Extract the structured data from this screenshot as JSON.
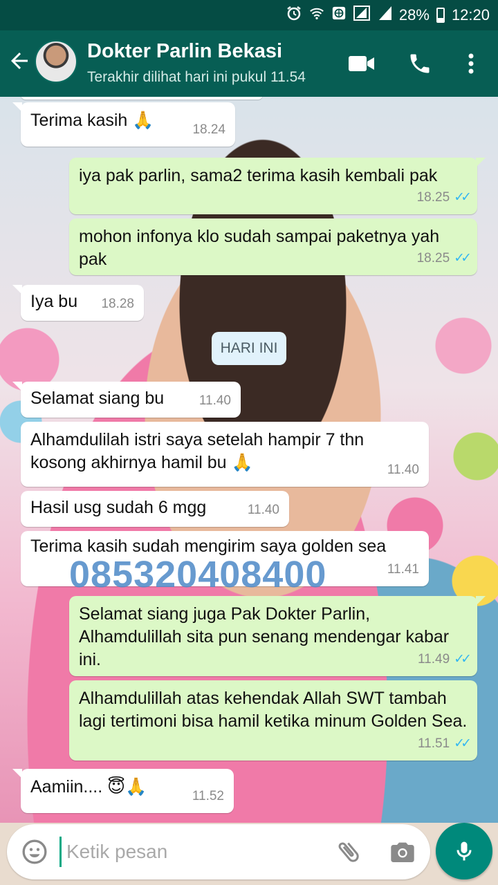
{
  "status_bar": {
    "battery": "28%",
    "time": "12:20"
  },
  "header": {
    "contact_name": "Dokter Parlin Bekasi",
    "last_seen": "Terakhir dilihat hari ini pukul 11.54"
  },
  "messages": [
    {
      "dir": "in",
      "text": "Terima kasih 🙏",
      "time": "18.24"
    },
    {
      "dir": "out",
      "text": "iya pak parlin, sama2 terima kasih kembali pak",
      "time": "18.25",
      "read": true
    },
    {
      "dir": "out",
      "text": "mohon infonya klo sudah sampai paketnya yah pak",
      "time": "18.25",
      "read": true
    },
    {
      "dir": "in",
      "text": "Iya bu",
      "time": "18.28"
    },
    {
      "dir": "in",
      "text": "Selamat siang bu",
      "time": "11.40"
    },
    {
      "dir": "in",
      "text": "Alhamdulilah istri saya setelah hampir 7 thn kosong akhirnya hamil bu 🙏",
      "time": "11.40"
    },
    {
      "dir": "in",
      "text": "Hasil usg sudah 6 mgg",
      "time": "11.40"
    },
    {
      "dir": "in",
      "text": "Terima kasih sudah mengirim saya golden sea",
      "time": "11.41"
    },
    {
      "dir": "out",
      "text": "Selamat siang juga Pak Dokter Parlin, Alhamdulillah sita pun senang mendengar kabar ini.",
      "time": "11.49",
      "read": true
    },
    {
      "dir": "out",
      "text": "Alhamdulillah atas kehendak Allah SWT tambah lagi tertimoni bisa hamil ketika minum Golden Sea.",
      "time": "11.51",
      "read": true
    },
    {
      "dir": "in",
      "text": "Aamiin.... 😇🙏",
      "time": "11.52"
    }
  ],
  "day_label": "HARI INI",
  "watermark": "085320408400",
  "composer": {
    "placeholder": "Ketik pesan"
  },
  "colors": {
    "header": "#075e54",
    "status_bar": "#054c44",
    "outgoing": "#dcf8c6",
    "incoming": "#ffffff",
    "mic": "#00897b",
    "read_ticks": "#34b7f1"
  },
  "icons": [
    "alarm-icon",
    "wifi-icon",
    "data-icon",
    "signal-icon",
    "battery-icon",
    "back-arrow-icon",
    "video-call-icon",
    "phone-icon",
    "more-vert-icon",
    "emoji-icon",
    "attach-icon",
    "camera-icon",
    "mic-icon"
  ]
}
